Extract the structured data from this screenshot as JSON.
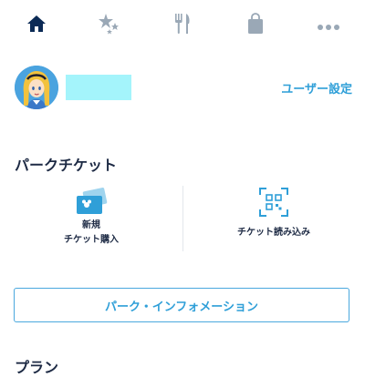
{
  "tabbar": {
    "items": [
      {
        "icon": "home-icon",
        "active": true
      },
      {
        "icon": "sparkle-stars-icon",
        "active": false
      },
      {
        "icon": "fork-knife-icon",
        "active": false
      },
      {
        "icon": "shopping-bag-icon",
        "active": false
      },
      {
        "icon": "more-dots-icon",
        "active": false
      }
    ],
    "active_color": "#0b2a55",
    "inactive_color": "#9aa8b6"
  },
  "profile": {
    "avatar_icon": "alice-avatar",
    "name_box_color": "#a4f4fb",
    "settings_label": "ユーザー設定"
  },
  "park_ticket": {
    "title": "パークチケット",
    "buy": {
      "line1": "新規",
      "line2": "チケット購入",
      "icon": "ticket-cards-icon"
    },
    "scan": {
      "label": "チケット読み込み",
      "icon": "qr-scan-icon"
    }
  },
  "info_button_label": "パーク・インフォメーション",
  "next_section_title": "プラン",
  "accent_color": "#2f9fd8"
}
